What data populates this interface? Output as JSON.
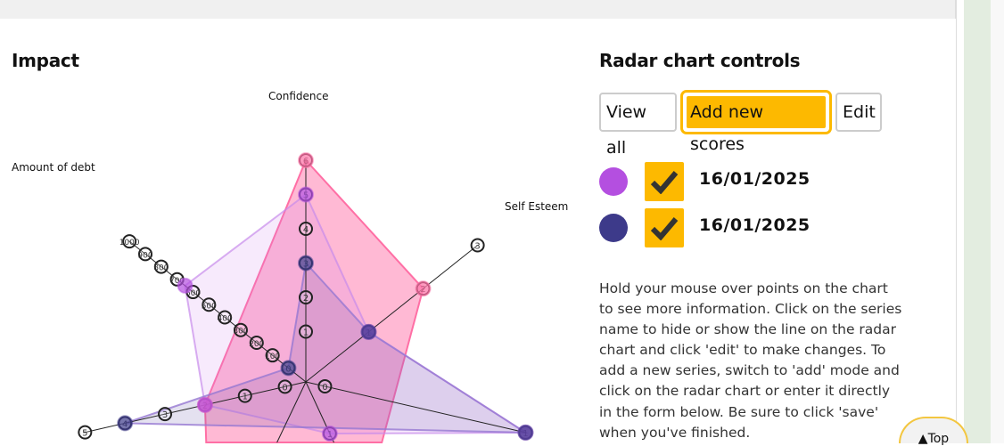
{
  "section_title": "Impact",
  "controls": {
    "title": "Radar chart controls",
    "view_all": "View all",
    "add_new": "Add new scores",
    "edit": "Edit"
  },
  "legend": [
    {
      "color": "#b44fe0",
      "checked": true,
      "date": "16/01/2025"
    },
    {
      "color": "#3d3a8a",
      "checked": true,
      "date": "16/01/2025"
    }
  ],
  "help_text": "Hold your mouse over points on the chart to see more information. Click on the series name to hide or show the line on the radar chart and click 'edit' to make changes. To add a new series, switch to 'add' mode and click on the radar chart or enter it directly in the form below. Be sure to click 'save' when you've finished.",
  "top_button": "▲Top",
  "chart_data": {
    "type": "radar",
    "axes": [
      {
        "label": "Confidence",
        "ticks": [
          1,
          2,
          3,
          4,
          5,
          6
        ]
      },
      {
        "label": "Self Esteem",
        "ticks": [
          1,
          2,
          3
        ]
      },
      {
        "label": "",
        "ticks": [
          0,
          1
        ]
      },
      {
        "label": "",
        "ticks": [
          1
        ]
      },
      {
        "label": "",
        "ticks": []
      },
      {
        "label": "",
        "ticks": [
          0,
          1,
          2,
          3,
          4,
          5
        ]
      },
      {
        "label": "Amount of debt",
        "ticks": [
          0,
          100,
          200,
          300,
          400,
          500,
          600,
          700,
          800,
          900,
          1000
        ]
      }
    ],
    "series": [
      {
        "color": "#ff6fa5",
        "values": [
          6,
          2,
          null,
          3,
          5,
          2,
          null
        ]
      },
      {
        "color": "#b44fe0",
        "values": [
          5,
          1,
          1,
          1,
          null,
          2,
          650
        ]
      },
      {
        "color": "#3d3a8a",
        "values": [
          3,
          1,
          1,
          null,
          null,
          4,
          0
        ]
      }
    ]
  }
}
